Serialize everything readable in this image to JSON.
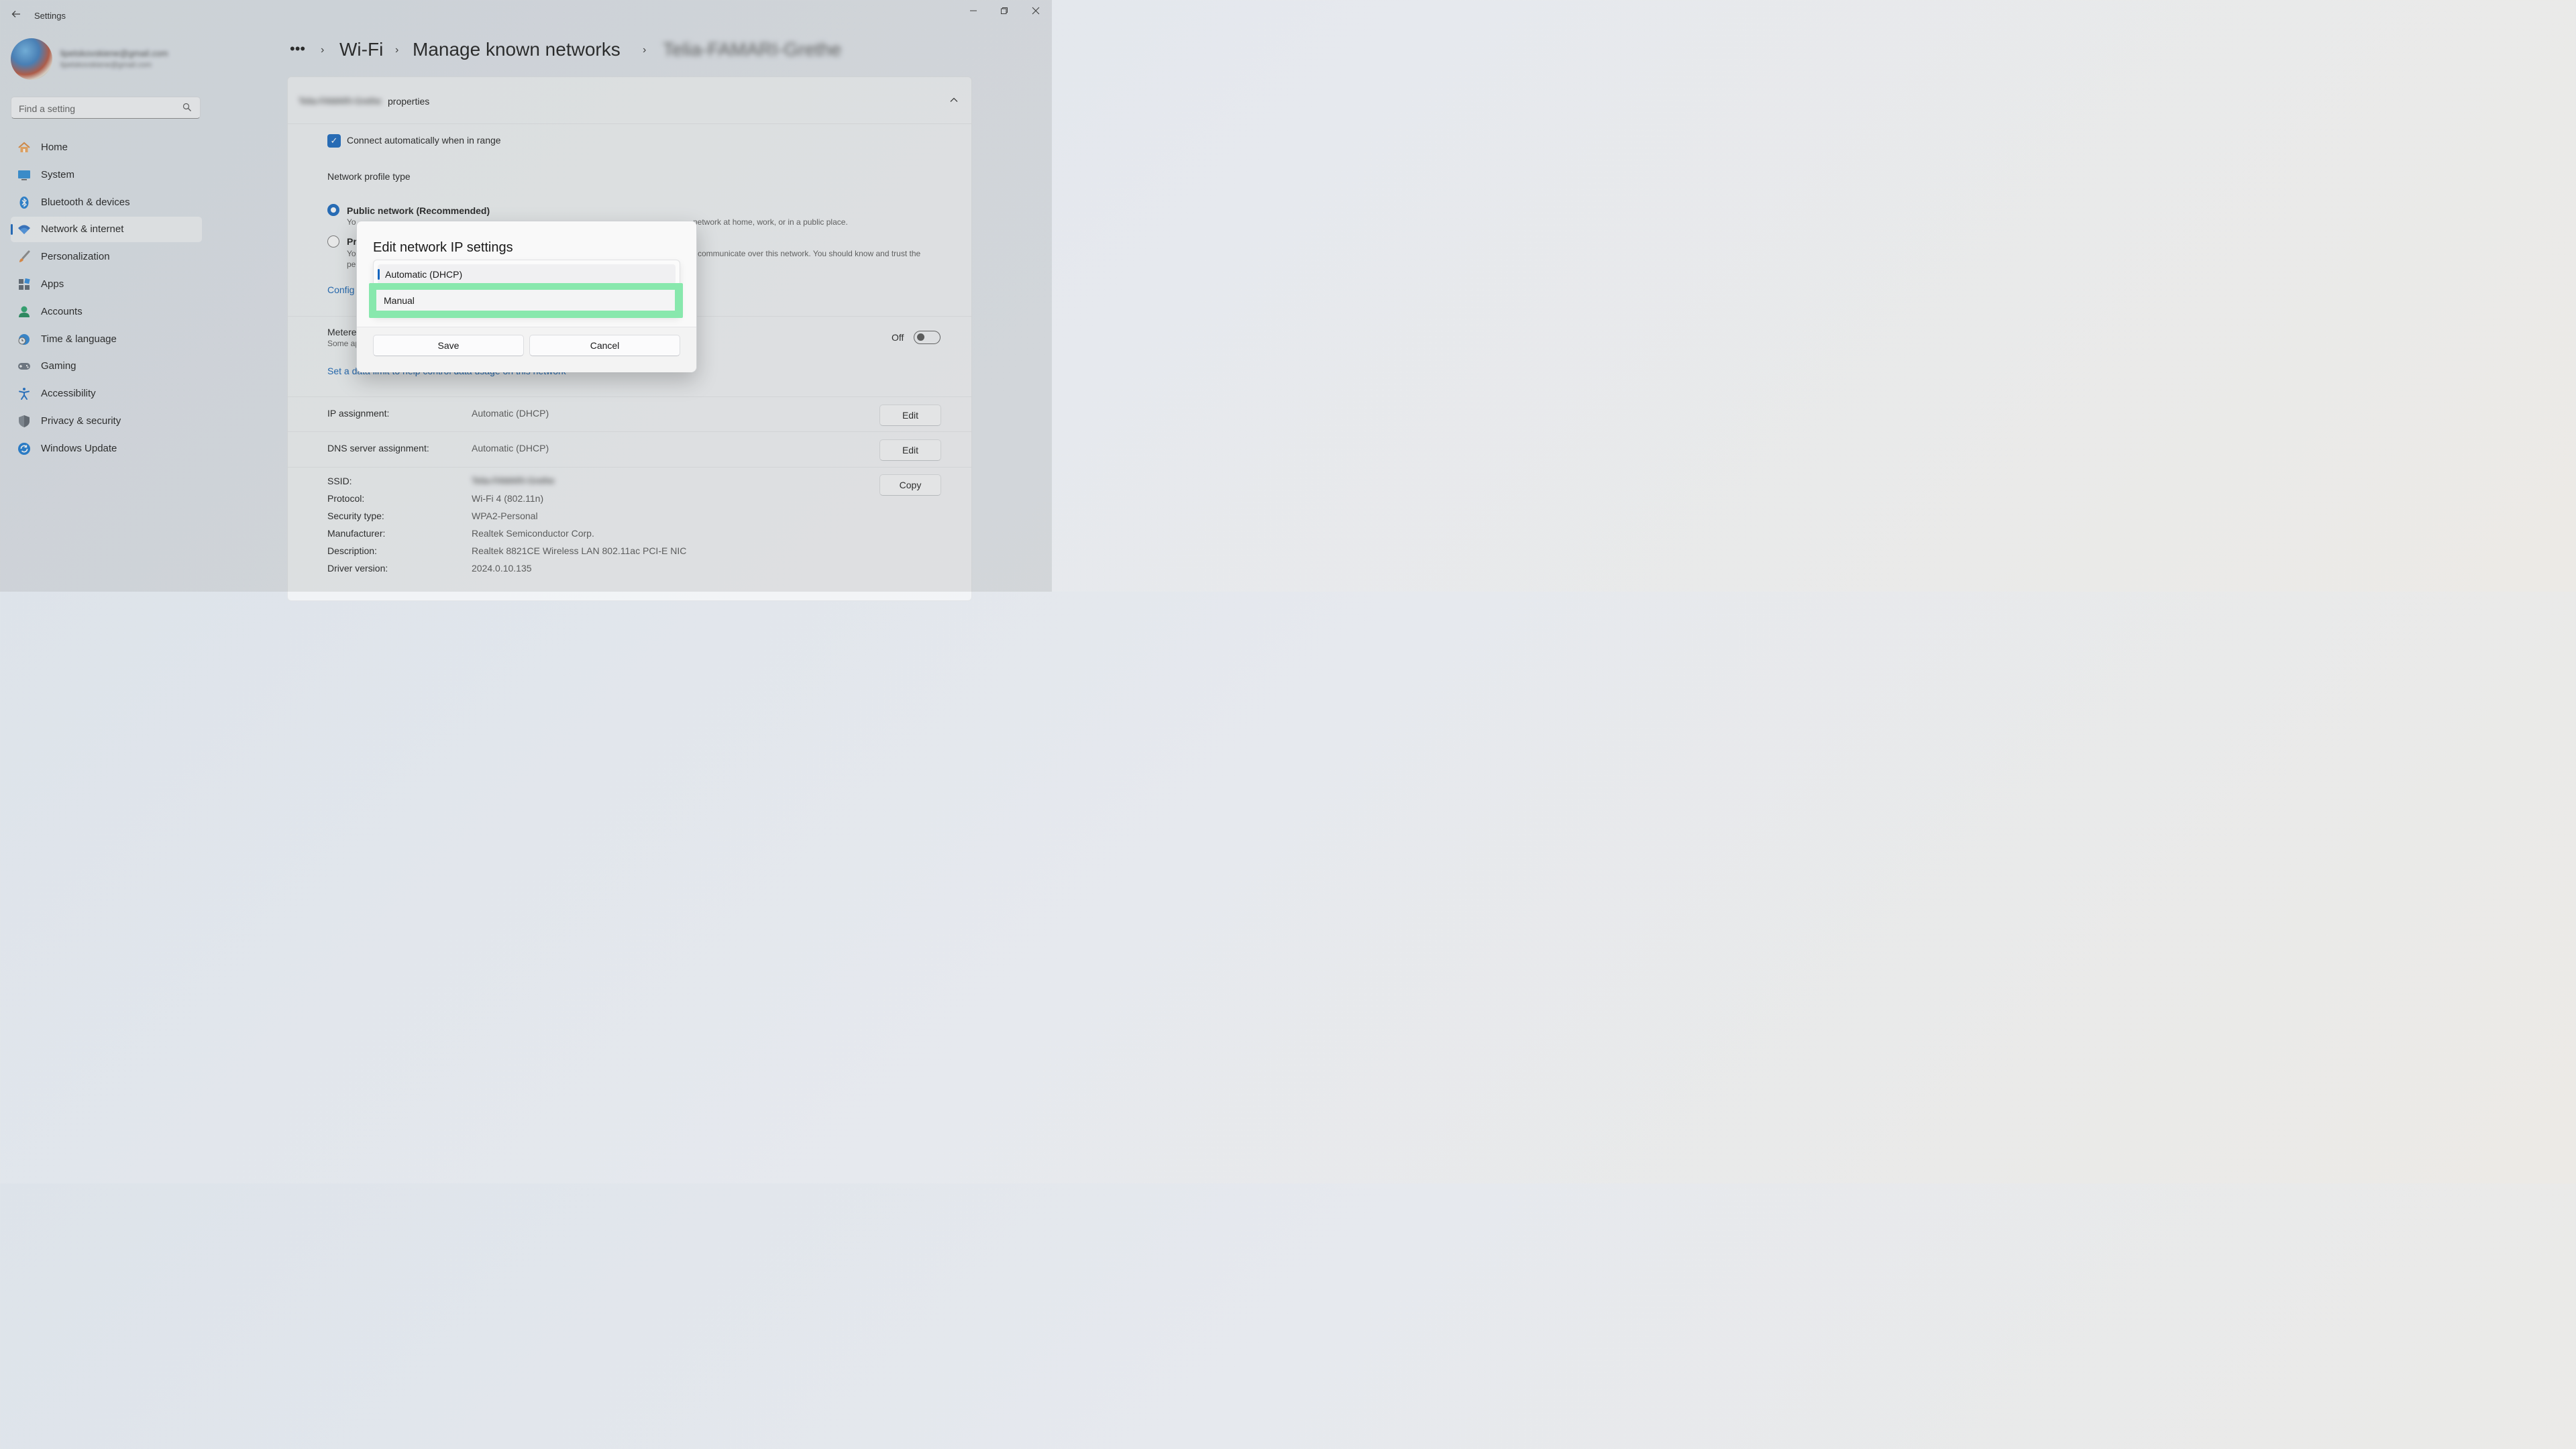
{
  "window": {
    "title": "Settings",
    "controls": [
      "minimize-icon",
      "restore-icon",
      "close-icon"
    ]
  },
  "account": {
    "name": "lipetskovskiene@gmail.com",
    "email": "lipetskovskiene@gmail.com"
  },
  "search": {
    "placeholder": "Find a setting"
  },
  "sidebar": {
    "items": [
      {
        "label": "Home",
        "icon": "home-icon"
      },
      {
        "label": "System",
        "icon": "monitor-icon"
      },
      {
        "label": "Bluetooth & devices",
        "icon": "bluetooth-icon"
      },
      {
        "label": "Network & internet",
        "icon": "wifi-icon",
        "selected": true
      },
      {
        "label": "Personalization",
        "icon": "brush-icon"
      },
      {
        "label": "Apps",
        "icon": "apps-icon"
      },
      {
        "label": "Accounts",
        "icon": "person-icon"
      },
      {
        "label": "Time & language",
        "icon": "globe-clock-icon"
      },
      {
        "label": "Gaming",
        "icon": "gamepad-icon"
      },
      {
        "label": "Accessibility",
        "icon": "accessibility-icon"
      },
      {
        "label": "Privacy & security",
        "icon": "shield-icon"
      },
      {
        "label": "Windows Update",
        "icon": "update-icon"
      }
    ]
  },
  "breadcrumb": {
    "more": "•••",
    "sep": "›",
    "wifi": "Wi-Fi",
    "manage": "Manage known networks",
    "network": "Telia-FAMARI-Grethe"
  },
  "properties": {
    "network_name": "Telia-FAMARI-Grethe",
    "header_suffix": "properties",
    "connect_auto": "Connect automatically when in range",
    "profile_type": "Network profile type",
    "public_label": "Public network (Recommended)",
    "public_desc_partial_left": "Yo",
    "public_desc_partial_right": "network at home, work, or in a public place.",
    "private_label_partial": "Pr",
    "private_desc_partial_left": "Yo",
    "private_desc_partial_left2": "pe",
    "private_desc_partial_right": "communicate over this network. You should know and trust the",
    "configure_partial": "Config",
    "metered_partial": "Metere",
    "metered_sub_partial": "Some ap",
    "metered_state": "Off",
    "data_limit_link": "Set a data limit to help control data usage on this network",
    "ip_assignment_label": "IP assignment:",
    "ip_assignment_value": "Automatic (DHCP)",
    "dns_label": "DNS server assignment:",
    "dns_value": "Automatic (DHCP)",
    "edit": "Edit",
    "copy": "Copy",
    "ssid_label": "SSID:",
    "ssid_value": "Telia-FAMARI-Grethe",
    "protocol_label": "Protocol:",
    "protocol_value": "Wi-Fi 4 (802.11n)",
    "security_label": "Security type:",
    "security_value": "WPA2-Personal",
    "manufacturer_label": "Manufacturer:",
    "manufacturer_value": "Realtek Semiconductor Corp.",
    "description_label": "Description:",
    "description_value": "Realtek 8821CE Wireless LAN 802.11ac PCI-E NIC",
    "driver_label": "Driver version:",
    "driver_value": "2024.0.10.135"
  },
  "dialog": {
    "title": "Edit network IP settings",
    "options": [
      "Automatic (DHCP)",
      "Manual"
    ],
    "selected": "Automatic (DHCP)",
    "highlighted": "Manual",
    "save": "Save",
    "cancel": "Cancel"
  },
  "colors": {
    "accent": "#1566c0",
    "highlight": "#88e8ad"
  }
}
